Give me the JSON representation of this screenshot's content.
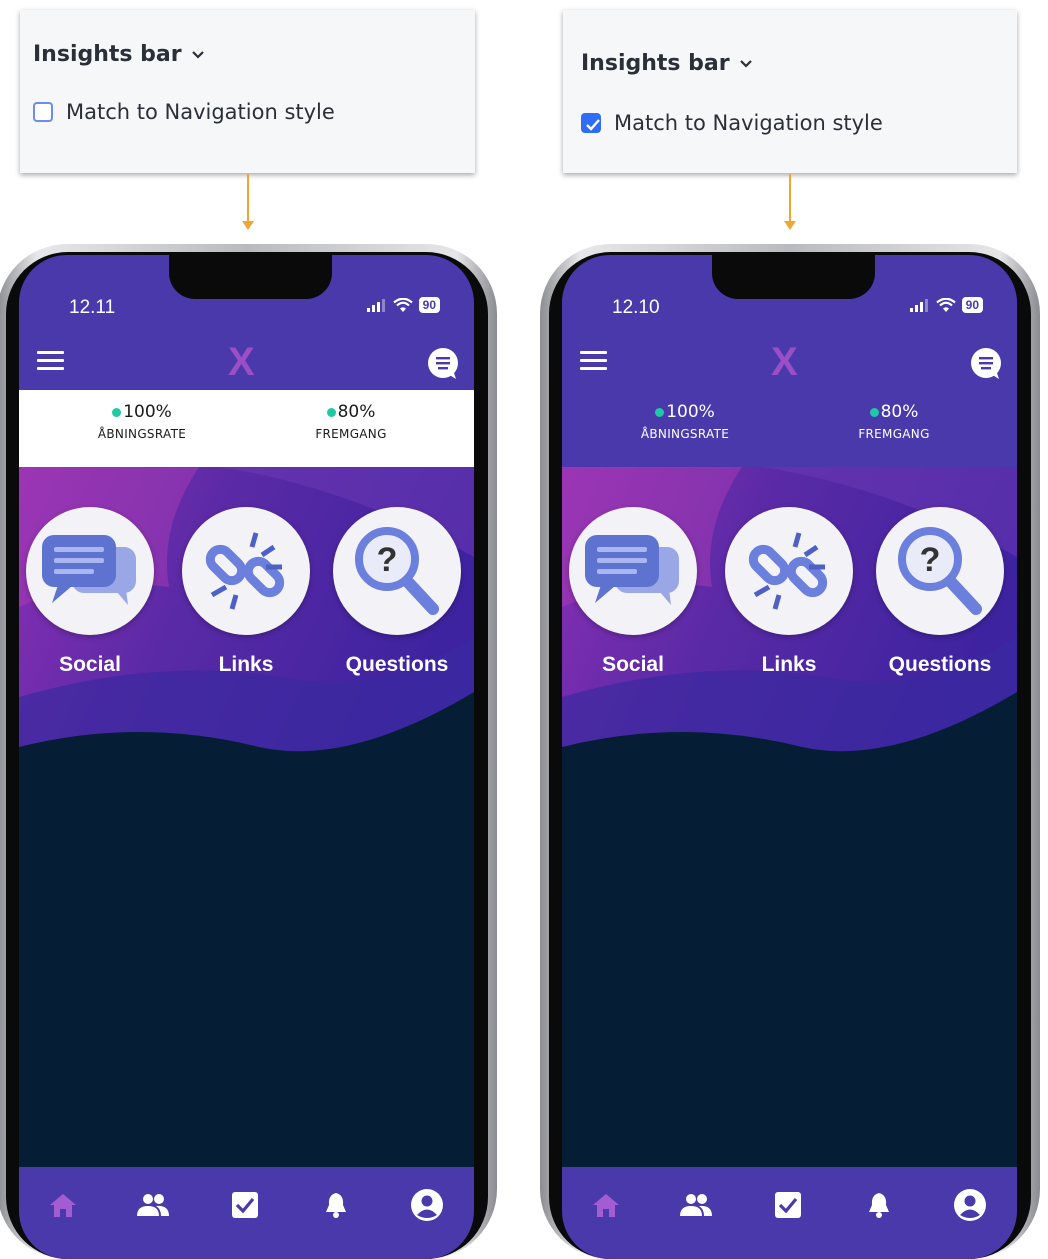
{
  "colors": {
    "accent_purple": "#4a39ab",
    "teal_dot": "#1ec9a3",
    "arrow_orange": "#f0a534",
    "checkbox_blue": "#2f6df6",
    "dark_body": "#051e36"
  },
  "left": {
    "panel": {
      "title": "Insights bar",
      "checkbox_label": "Match to Navigation style",
      "checked": false
    },
    "phone": {
      "time": "12.11",
      "battery": "90",
      "logo": "X",
      "insights": [
        {
          "value": "100%",
          "label": "ÅBNINGSRATE"
        },
        {
          "value": "80%",
          "label": "FREMGANG"
        }
      ],
      "tiles": [
        {
          "label": "Social",
          "icon": "chat-bubbles-icon"
        },
        {
          "label": "Links",
          "icon": "broken-link-icon"
        },
        {
          "label": "Questions",
          "icon": "question-magnifier-icon"
        }
      ],
      "nav": [
        "home-icon",
        "people-icon",
        "checkbox-icon",
        "bell-icon",
        "account-icon"
      ]
    }
  },
  "right": {
    "panel": {
      "title": "Insights bar",
      "checkbox_label": "Match to Navigation style",
      "checked": true
    },
    "phone": {
      "time": "12.10",
      "battery": "90",
      "logo": "X",
      "insights": [
        {
          "value": "100%",
          "label": "ÅBNINGSRATE"
        },
        {
          "value": "80%",
          "label": "FREMGANG"
        }
      ],
      "tiles": [
        {
          "label": "Social",
          "icon": "chat-bubbles-icon"
        },
        {
          "label": "Links",
          "icon": "broken-link-icon"
        },
        {
          "label": "Questions",
          "icon": "question-magnifier-icon"
        }
      ],
      "nav": [
        "home-icon",
        "people-icon",
        "checkbox-icon",
        "bell-icon",
        "account-icon"
      ]
    }
  }
}
